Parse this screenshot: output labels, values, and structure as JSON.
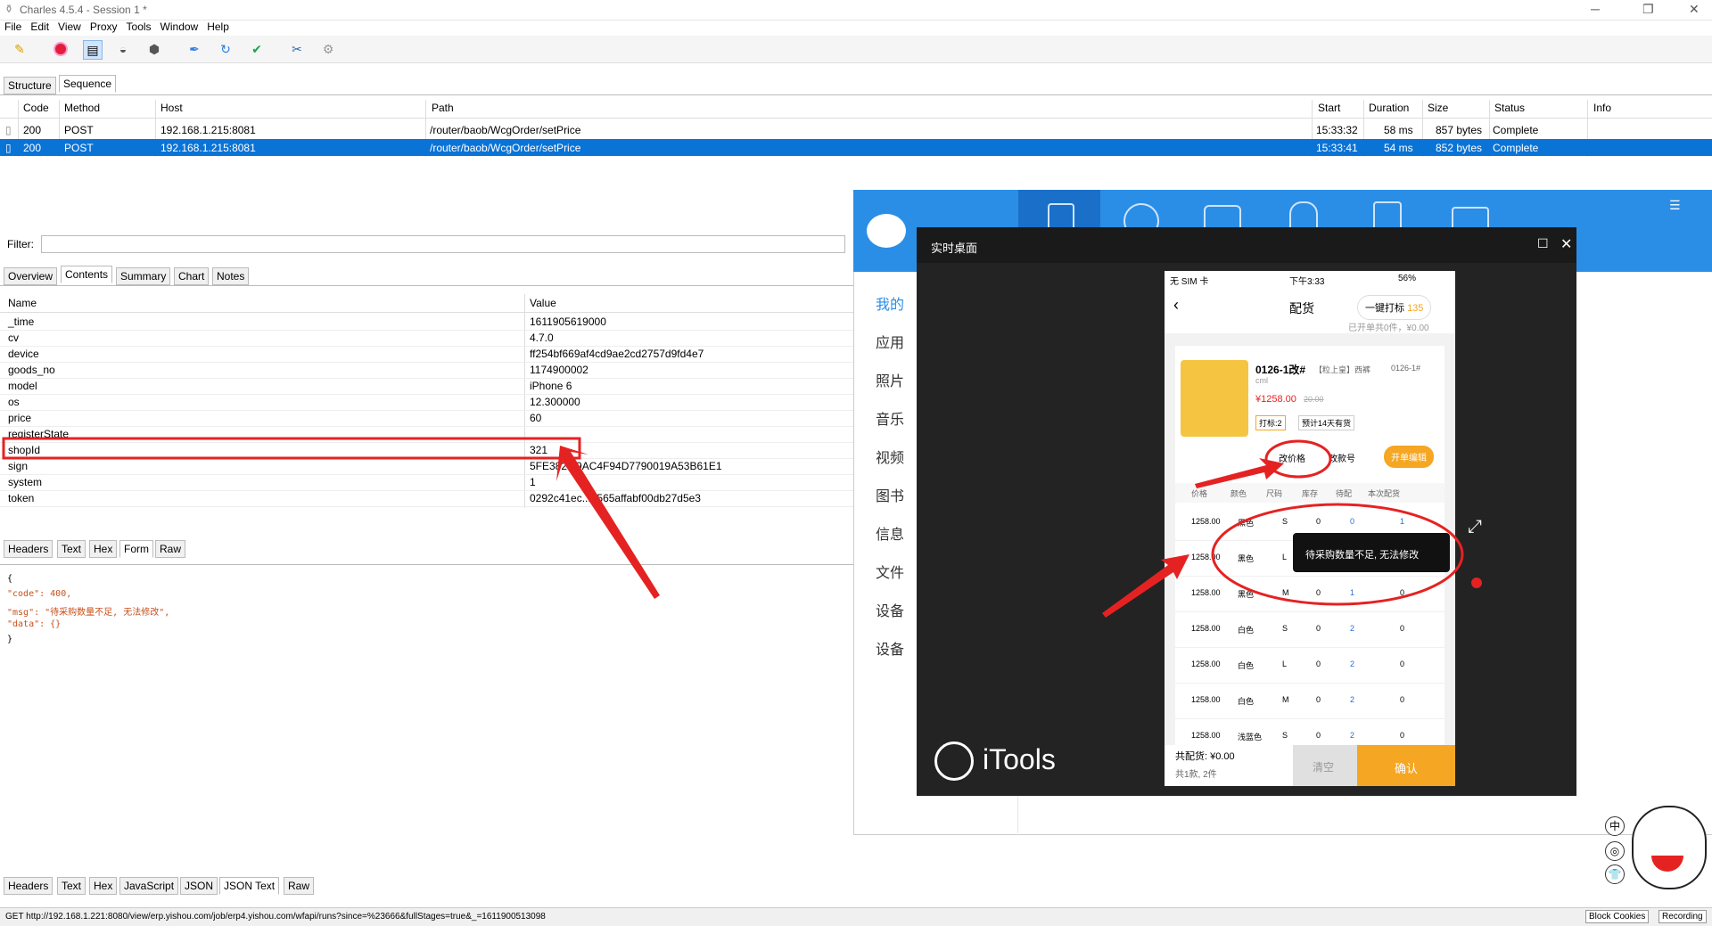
{
  "window": {
    "title": "Charles 4.5.4 - Session 1 *",
    "controls": [
      "─",
      "❐",
      "✕"
    ]
  },
  "menu": [
    "File",
    "Edit",
    "View",
    "Proxy",
    "Tools",
    "Window",
    "Help"
  ],
  "top_tabs": [
    "Structure",
    "Sequence"
  ],
  "grid": {
    "columns": [
      "Code",
      "Method",
      "Host",
      "Path",
      "Start",
      "Duration",
      "Size",
      "Status",
      "Info"
    ],
    "rows": [
      {
        "code": "200",
        "method": "POST",
        "host": "192.168.1.215:8081",
        "path": "/router/baob/WcgOrder/setPrice",
        "start": "15:33:32",
        "duration": "58 ms",
        "size": "857 bytes",
        "status": "Complete"
      },
      {
        "code": "200",
        "method": "POST",
        "host": "192.168.1.215:8081",
        "path": "/router/baob/WcgOrder/setPrice",
        "start": "15:33:41",
        "duration": "54 ms",
        "size": "852 bytes",
        "status": "Complete"
      }
    ]
  },
  "filter": {
    "label": "Filter:",
    "value": ""
  },
  "detail_tabs": [
    "Overview",
    "Contents",
    "Summary",
    "Chart",
    "Notes"
  ],
  "form": {
    "columns": [
      "Name",
      "Value"
    ],
    "rows": [
      {
        "name": "_time",
        "value": "1611905619000"
      },
      {
        "name": "cv",
        "value": "4.7.0"
      },
      {
        "name": "device",
        "value": "ff254bf669af4cd9ae2cd2757d9fd4e7"
      },
      {
        "name": "goods_no",
        "value": "1174900002"
      },
      {
        "name": "model",
        "value": "iPhone 6"
      },
      {
        "name": "os",
        "value": "12.300000"
      },
      {
        "name": "price",
        "value": "60"
      },
      {
        "name": "registerState",
        "value": ""
      },
      {
        "name": "shopId",
        "value": "321"
      },
      {
        "name": "sign",
        "value": "5FE382...9AC4F94D7790019A53B61E1"
      },
      {
        "name": "system",
        "value": "1"
      },
      {
        "name": "token",
        "value": "0292c41ec...3565affabf00db27d5e3"
      }
    ]
  },
  "req_tabs": [
    "Headers",
    "Text",
    "Hex",
    "Form",
    "Raw"
  ],
  "response_json": [
    "{",
    "  \"code\": 400,",
    "  \"msg\": \"待采购数量不足, 无法修改\",",
    "  \"data\": {}",
    "}"
  ],
  "resp_tabs": [
    "Headers",
    "Text",
    "Hex",
    "JavaScript",
    "JSON",
    "JSON Text",
    "Raw"
  ],
  "status": {
    "text": "GET http://192.168.1.221:8080/view/erp.yishou.com/job/erp4.yishou.com/wfapi/runs?since=%23666&fullStages=true&_=1611900513098",
    "btn1": "Block Cookies",
    "btn2": "Recording"
  },
  "itools": {
    "sidebar": [
      "我的",
      "应用",
      "照片",
      "音乐",
      "视频",
      "图书",
      "信息",
      "文件",
      "设备",
      "设备"
    ],
    "realtime_title": "实时桌面",
    "brand": "iTools"
  },
  "phone": {
    "carrier": "无 SIM 卡",
    "time": "下午3:33",
    "battery": "56%",
    "page_title": "配货",
    "mark_btn": "一键打标",
    "mark_count": "135",
    "summary_line": "已开单共0件，¥0.00",
    "product_title": "0126-1改#",
    "product_tag": "【粒上皇】西裤",
    "product_code": "0126-1#",
    "product_sub": "cml",
    "price": "¥1258.00",
    "orig_price": "20.00",
    "tag1": "打标:2",
    "tag2": "预计14天有货",
    "btn_change_price": "改价格",
    "btn_change_no": "改款号",
    "btn_edit": "开单编辑",
    "table_headers": [
      "价格",
      "颜色",
      "尺码",
      "库存",
      "待配",
      "本次配货"
    ],
    "table_rows": [
      [
        "1258.00",
        "黑色",
        "S",
        "0",
        "0",
        "1"
      ],
      [
        "1258.00",
        "黑色",
        "L",
        "0",
        "1",
        "1"
      ],
      [
        "1258.00",
        "黑色",
        "M",
        "0",
        "1",
        "0"
      ],
      [
        "1258.00",
        "白色",
        "S",
        "0",
        "2",
        "0"
      ],
      [
        "1258.00",
        "白色",
        "L",
        "0",
        "2",
        "0"
      ],
      [
        "1258.00",
        "白色",
        "M",
        "0",
        "2",
        "0"
      ],
      [
        "1258.00",
        "浅蓝色",
        "S",
        "0",
        "2",
        "0"
      ]
    ],
    "toast": "待采购数量不足, 无法修改",
    "total_label": "共配货: ¥0.00",
    "total_sub": "共1款, 2件",
    "confirm": "确认",
    "reset": "清空"
  },
  "ime": [
    "中",
    "◎",
    "👕"
  ]
}
